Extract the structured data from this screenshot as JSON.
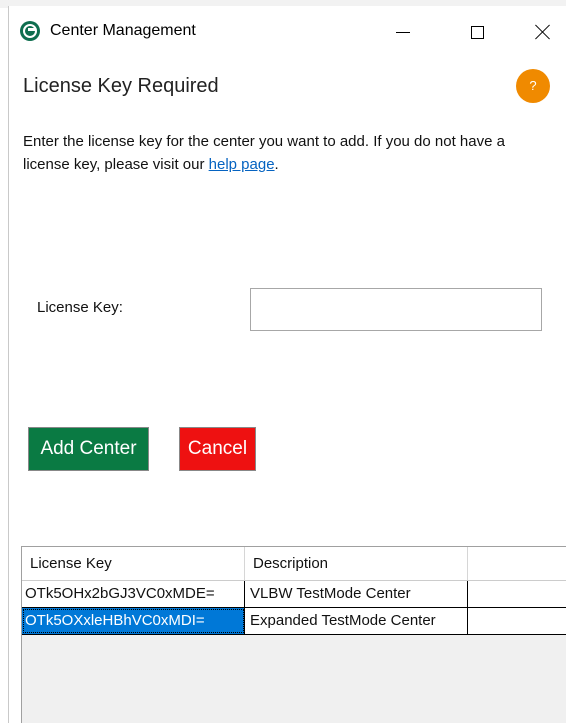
{
  "window": {
    "title": "Center Management",
    "app_icon_glyph": "@",
    "controls": {
      "minimize": "minimize-icon",
      "maximize": "maximize-icon",
      "close": "close-icon"
    }
  },
  "header": {
    "title": "License Key Required",
    "help_glyph": "?",
    "help_color": "#f08a00"
  },
  "instructions": {
    "text": "Enter the license key for the center you want to add. If you do not have a license key, please visit our ",
    "link_text": "help page",
    "suffix": "."
  },
  "form": {
    "license_key_label": "License Key:",
    "license_key_value": "",
    "license_key_placeholder": ""
  },
  "buttons": {
    "add_center": "Add Center",
    "add_center_color": "#0a7a43",
    "cancel": "Cancel",
    "cancel_color": "#ee1111"
  },
  "table": {
    "columns": [
      "License Key",
      "Description",
      ""
    ],
    "rows": [
      {
        "license_key": "OTk5OHx2bGJ3VC0xMDE=",
        "description": "VLBW TestMode Center",
        "selected": false
      },
      {
        "license_key": "OTk5OXxleHBhVC0xMDI=",
        "description": "Expanded TestMode Center",
        "selected": true
      }
    ],
    "selection_color": "#0078d7"
  }
}
